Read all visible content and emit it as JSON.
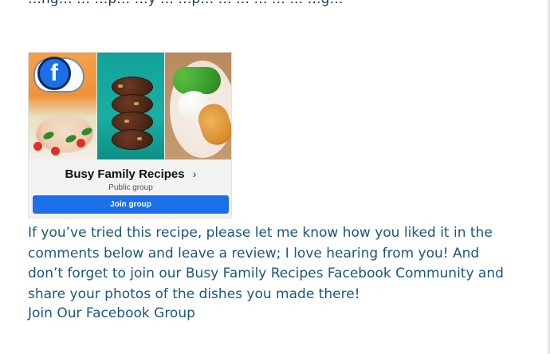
{
  "page": {
    "top_line_partial": "…ng… … …p… …y … …p… … … … … … …g…",
    "paragraph": "If you’ve tried this recipe, please let me know how you liked it in the comments below and leave a review; I love hearing from you! And don’t forget to join our Busy Family Recipes Facebook Community and share your photos of the dishes you made there!",
    "link_text": "Join Our Facebook Group"
  },
  "card": {
    "title": "Busy Family Recipes",
    "subtitle": "Public group",
    "button_label": "Join group",
    "chevron": "›",
    "fb_letter": "f"
  },
  "colors": {
    "link_text": "#1b567e",
    "facebook_blue": "#1b6fe8"
  },
  "icons": {
    "facebook_badge": "facebook-icon",
    "chevron": "chevron-right-icon"
  }
}
